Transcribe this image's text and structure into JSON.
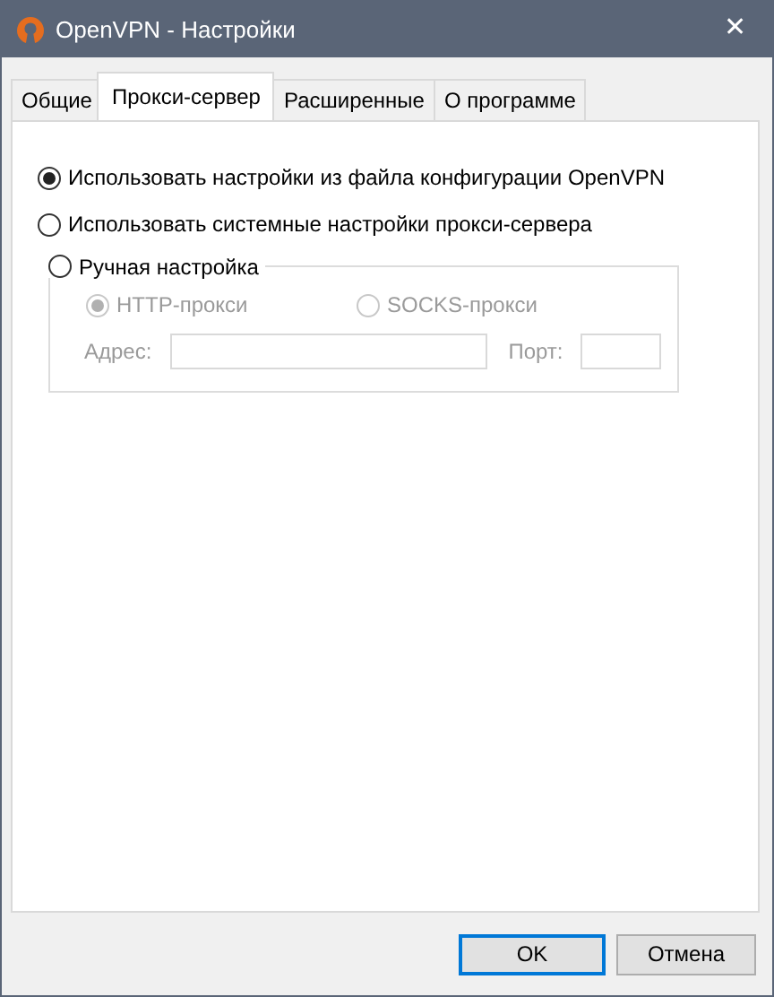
{
  "window": {
    "title": "OpenVPN - Настройки",
    "close": "✕"
  },
  "tabs": [
    {
      "label": "Общие",
      "selected": false
    },
    {
      "label": "Прокси-сервер",
      "selected": true
    },
    {
      "label": "Расширенные",
      "selected": false
    },
    {
      "label": "О программе",
      "selected": false
    }
  ],
  "proxy_options": [
    {
      "label": "Использовать настройки из файла конфигурации OpenVPN",
      "selected": true
    },
    {
      "label": "Использовать системные настройки прокси-сервера",
      "selected": false
    },
    {
      "label": "Ручная настройка",
      "selected": false
    }
  ],
  "manual": {
    "disabled": true,
    "types": [
      {
        "label": "HTTP-прокси",
        "selected": true
      },
      {
        "label": "SOCKS-прокси",
        "selected": false
      }
    ],
    "address_label": "Адрес:",
    "port_label": "Порт:"
  },
  "buttons": [
    {
      "label": "OK",
      "default": true
    },
    {
      "label": "Отмена",
      "default": false
    }
  ]
}
